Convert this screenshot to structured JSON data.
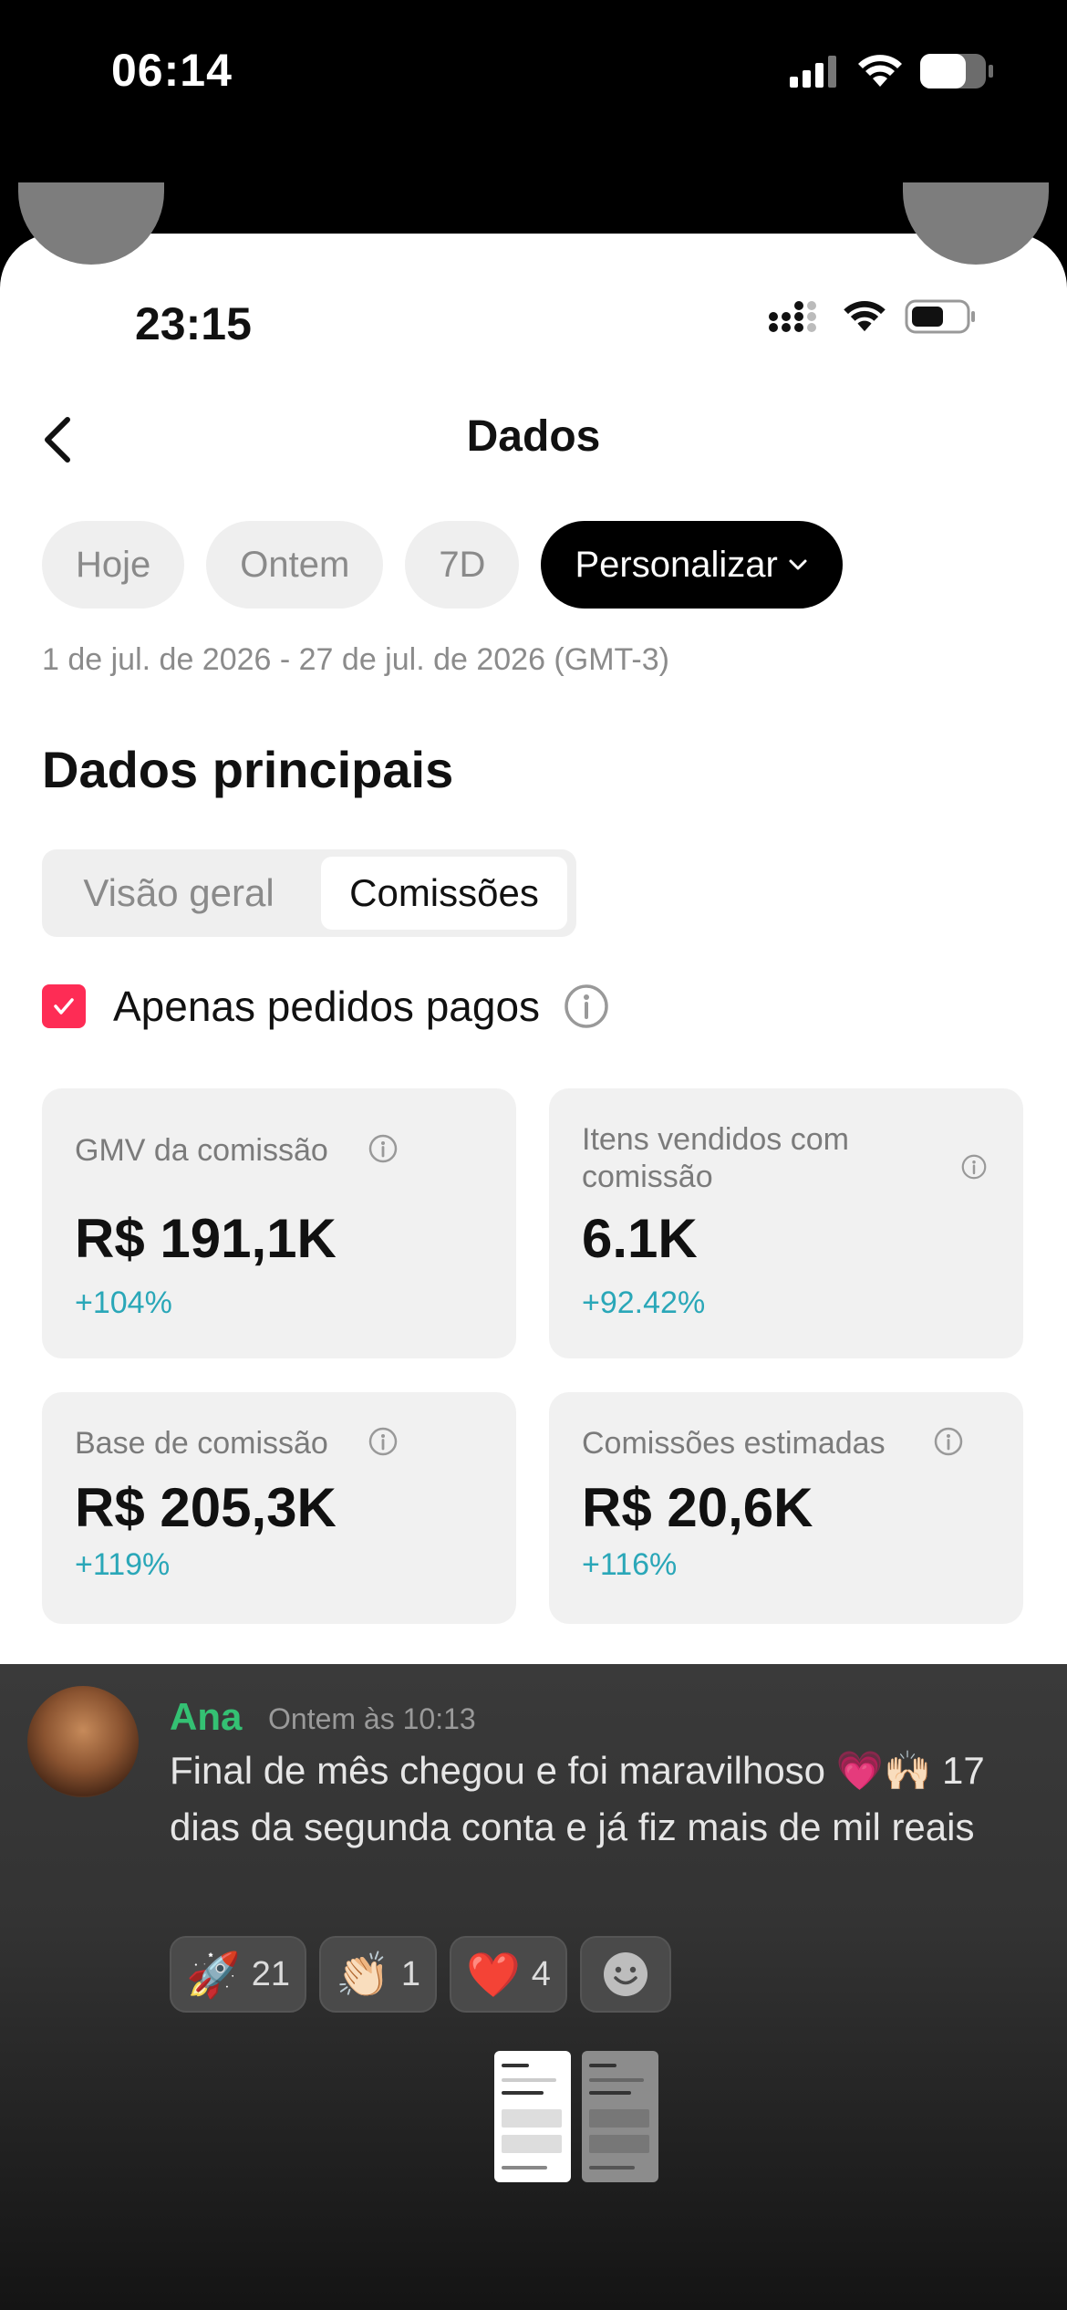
{
  "outer_status": {
    "time": "06:14"
  },
  "inner_status": {
    "time": "23:15"
  },
  "header": {
    "title": "Dados"
  },
  "chips": [
    {
      "label": "Hoje",
      "active": false
    },
    {
      "label": "Ontem",
      "active": false
    },
    {
      "label": "7D",
      "active": false
    },
    {
      "label": "Personalizar",
      "active": true
    }
  ],
  "date_range": "1 de jul. de 2026 - 27 de jul. de 2026 (GMT-3)",
  "section_title": "Dados principais",
  "segment": {
    "option_1": "Visão geral",
    "option_2": "Comissões",
    "selected": "Comissões"
  },
  "filter": {
    "label": "Apenas pedidos pagos",
    "checked": true
  },
  "metrics": [
    {
      "label": "GMV da comissão",
      "value": "R$ 191,1K",
      "delta": "+104%"
    },
    {
      "label": "Itens vendidos com comissão",
      "value": "6.1K",
      "delta": "+92.42%"
    },
    {
      "label": "Base de comissão",
      "value": "R$ 205,3K",
      "delta": "+119%"
    },
    {
      "label": "Comissões estimadas",
      "value": "R$ 20,6K",
      "delta": "+116%"
    }
  ],
  "chat": {
    "author": "Ana",
    "timestamp": "Ontem às 10:13",
    "message": "Final de mês chegou e foi maravilhoso 💗🙌🏻 17 dias da segunda conta e já fiz mais de mil reais",
    "reactions": [
      {
        "emoji": "🚀",
        "count": "21"
      },
      {
        "emoji": "👏🏻",
        "count": "1"
      },
      {
        "emoji": "❤️",
        "count": "4"
      }
    ]
  },
  "colors": {
    "accent": "#fe2c55",
    "delta": "#2aa7b8",
    "author": "#34c173"
  }
}
